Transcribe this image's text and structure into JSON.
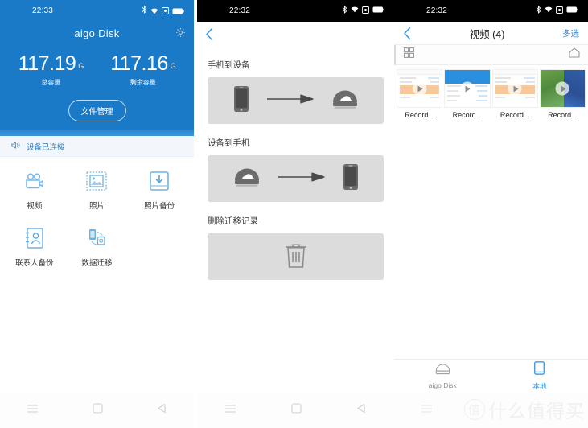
{
  "panel1": {
    "statusbar": {
      "time": "22:33",
      "icons": [
        "bluetooth-icon",
        "wifi-icon",
        "screenshot-icon",
        "battery-icon"
      ]
    },
    "app_title": "aigo Disk",
    "settings_icon": "gear-icon",
    "capacity": [
      {
        "value": "117.19",
        "unit": "G",
        "label": "总容量"
      },
      {
        "value": "117.16",
        "unit": "G",
        "label": "剩余容量"
      }
    ],
    "file_manager_button": "文件管理",
    "connection": {
      "icon": "speaker-icon",
      "text": "设备已连接"
    },
    "apps": [
      {
        "icon": "video-camera-icon",
        "label": "视频"
      },
      {
        "icon": "photo-frame-icon",
        "label": "照片"
      },
      {
        "icon": "photo-backup-icon",
        "label": "照片备份"
      },
      {
        "icon": "contacts-backup-icon",
        "label": "联系人备份"
      },
      {
        "icon": "data-migration-icon",
        "label": "数据迁移"
      }
    ],
    "navbar": [
      "menu-icon",
      "home-icon",
      "back-icon"
    ]
  },
  "panel2": {
    "statusbar": {
      "time": "22:32"
    },
    "back_icon": "chevron-left-icon",
    "sections": [
      {
        "title": "手机到设备",
        "from": "phone-icon",
        "arrow": "arrow-right-icon",
        "to": "disk-icon"
      },
      {
        "title": "设备到手机",
        "from": "disk-icon",
        "arrow": "arrow-right-icon",
        "to": "phone-icon"
      },
      {
        "title": "删除迁移记录",
        "single": "trash-icon"
      }
    ],
    "navbar": [
      "menu-icon",
      "home-icon",
      "back-icon"
    ]
  },
  "panel3": {
    "statusbar": {
      "time": "22:32"
    },
    "back_icon": "chevron-left-icon",
    "title": "视频 (4)",
    "multiselect": "多选",
    "toolbar": {
      "grid_icon": "grid-view-icon",
      "home_icon": "home-icon"
    },
    "gallery": [
      {
        "name": "Record...",
        "thumb": "doc-orange"
      },
      {
        "name": "Record...",
        "thumb": "doc-blue"
      },
      {
        "name": "Record...",
        "thumb": "doc-orange"
      },
      {
        "name": "Record...",
        "thumb": "game-screenshot"
      }
    ],
    "tabs": [
      {
        "icon": "disk-icon",
        "label": "aigo Disk",
        "active": false
      },
      {
        "icon": "phone-icon",
        "label": "本地",
        "active": true
      }
    ],
    "watermark": "什么值得买",
    "watermark_badge": "值",
    "navbar": [
      "menu-icon",
      "home-icon",
      "back-icon"
    ]
  },
  "colors": {
    "brand_blue": "#1b7ac8",
    "accent_blue": "#2d8cdb",
    "card_gray": "#dcdcdc",
    "status_black": "#000000"
  }
}
